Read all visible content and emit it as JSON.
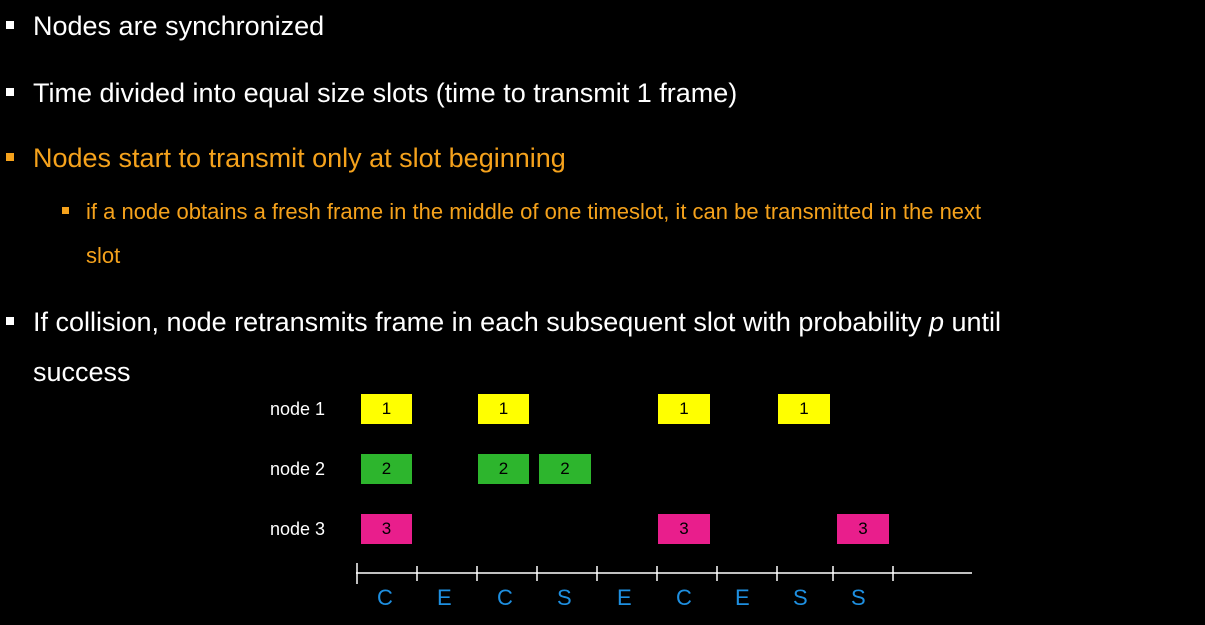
{
  "bullets": [
    {
      "text": "Nodes are synchronized"
    },
    {
      "text": "Time divided into equal size slots (time to transmit 1 frame)"
    },
    {
      "text": "Nodes start to transmit only at slot beginning"
    }
  ],
  "sub_bullet": {
    "line1": "if a node obtains a fresh frame in the middle of one timeslot, it can be transmitted in the next",
    "line2": "slot"
  },
  "last_bullet": {
    "line1_pre": "If collision, node retransmits frame in each subsequent slot with probability ",
    "line1_var": "p",
    "line1_post": " until",
    "line2": "success"
  },
  "diagram": {
    "nodes": [
      {
        "label": "node 1",
        "frame": "1",
        "color": "#ffff00"
      },
      {
        "label": "node 2",
        "frame": "2",
        "color": "#2db52d"
      },
      {
        "label": "node 3",
        "frame": "3",
        "color": "#e91e8c"
      }
    ],
    "slot_labels": [
      "C",
      "E",
      "C",
      "S",
      "E",
      "C",
      "E",
      "S",
      "S"
    ]
  }
}
